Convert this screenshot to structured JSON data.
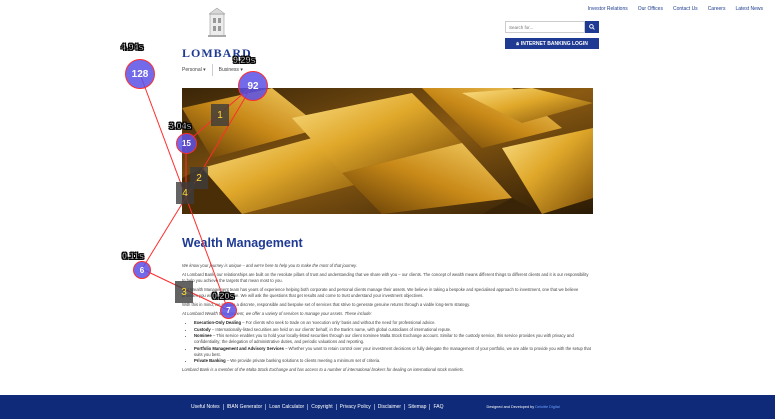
{
  "top_links": [
    "Investor Relations",
    "Our Offices",
    "Contact Us",
    "Careers",
    "Latest News"
  ],
  "search": {
    "placeholder": "Search for..."
  },
  "login_label": "INTERNET BANKING LOGIN",
  "logo_text": "LOMBARD",
  "nav": [
    "Personal ▾",
    "Business ▾"
  ],
  "page_title": "Wealth Management",
  "content": {
    "intro_italic": "We know your journey is unique – and we're here to help you to make the most of that journey.",
    "p1": "At Lombard Bank, our relationships are built on the resolute pillars of trust and understanding that we share with you – our clients. The concept of wealth means different things to different clients and it is our responsibility to help you achieve the targets that mean most to you.",
    "p2": "Our Wealth Management team has years of experience helping both corporate and personal clients manage their assets. We believe in taking a bespoke and specialised approach to investment, one that we believe provides you with added value. We will ask the questions that get results and come to trust understand your investment objectives.",
    "p3": "With this in mind, we provide a discrete, responsible and bespoke set of services that strive to generate genuine returns through a viable long-term strategy.",
    "offer_italic": "At Lombard Wealth Management, we offer a variety of services to manage your assets. These include:",
    "services": [
      {
        "name": "Execution-Only Dealing",
        "desc": " – For clients who seek to trade on an 'execution only' basis and without the need for professional advice."
      },
      {
        "name": "Custody",
        "desc": " – Internationally-listed securities are held on our clients' behalf, in the Bank's name, with global custodians of international repute."
      },
      {
        "name": "Nominee",
        "desc": " – This service enables you to hold your locally-listed securities through our client nominee Malta Stock Exchange account. Similar to the custody service, this service provides you with privacy and confidentiality; the delegation of administrative duties, and periodic valuations and reporting."
      },
      {
        "name": "Portfolio Management and Advisory Services",
        "desc": " – Whether you want to retain control over your investment decisions or fully delegate the management of your portfolio, we are able to provide you with the setup that suits you best."
      },
      {
        "name": "Private Banking",
        "desc": " – We provide private banking solutions to clients meeting a minimum set of criteria."
      }
    ],
    "closing_italic": "Lombard Bank is a member of the Malta Stock Exchange and has access to a number of international brokers for dealing on international stock markets."
  },
  "footer": {
    "links": [
      "Useful Notes",
      "IBAN Generator",
      "Loan Calculator",
      "Copyright",
      "Privacy Policy",
      "Disclaimer",
      "Sitemap",
      "FAQ"
    ],
    "credit_prefix": "Designed and Developed by ",
    "credit_name": "Deloitte Digital"
  },
  "gaze": {
    "fixations": [
      {
        "id": "128",
        "label": "4.94s"
      },
      {
        "id": "92",
        "label": "9.29s"
      },
      {
        "id": "15",
        "label": "3.04s"
      },
      {
        "id": "6",
        "label": "0.11s"
      },
      {
        "id": "7",
        "label": "0.20s"
      }
    ],
    "boxes": [
      "1",
      "2",
      "3",
      "4"
    ]
  },
  "colors": {
    "brand": "#1f3a93",
    "footer": "#0e2a78",
    "gaze_fill": "#5a50e6",
    "gaze_line": "#ff2d2d"
  }
}
